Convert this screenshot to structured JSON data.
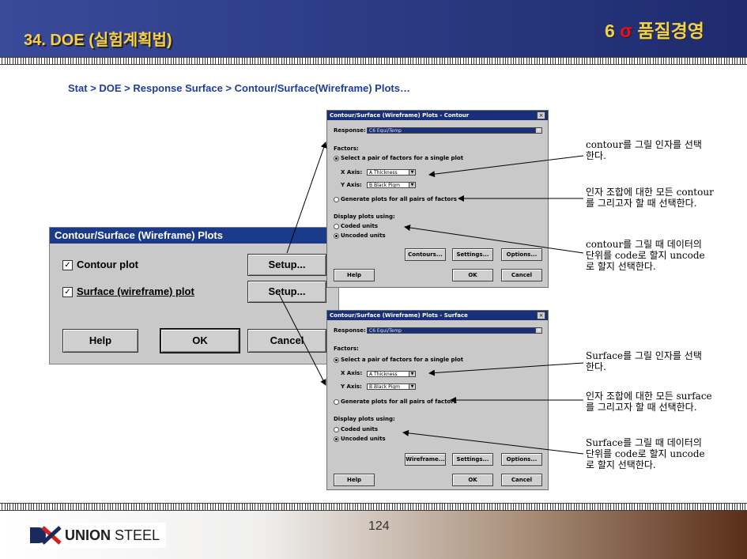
{
  "header": {
    "title": "34. DOE (실험계획법)",
    "brand_num": "6",
    "brand_sigma": "σ",
    "brand_text": "품질경영"
  },
  "path": "Stat > DOE > Response  Surface > Contour/Surface(Wireframe)  Plots…",
  "main_dialog": {
    "title": "Contour/Surface (Wireframe) Plots",
    "contour_label": "Contour plot",
    "surface_label": "Surface (wireframe) plot",
    "setup1": "Setup...",
    "setup2": "Setup...",
    "help": "Help",
    "ok": "OK",
    "cancel": "Cancel"
  },
  "contour_dialog": {
    "title": "Contour/Surface (Wireframe) Plots - Contour",
    "response_label": "Response:",
    "response_value": "C6     Equi/Temp",
    "factors": "Factors:",
    "single_pair": "Select a pair of factors for a single plot",
    "xaxis_label": "X Axis:",
    "xaxis_value": "A Thickness",
    "yaxis_label": "Y Axis:",
    "yaxis_value": "B Black Pigm",
    "all_pairs": "Generate plots for all pairs of factors",
    "display": "Display plots using:",
    "coded": "Coded units",
    "uncoded": "Uncoded units",
    "btn1": "Contours...",
    "btn2": "Settings...",
    "btn3": "Options...",
    "help": "Help",
    "ok": "OK",
    "cancel": "Cancel"
  },
  "surface_dialog": {
    "title": "Contour/Surface (Wireframe) Plots - Surface",
    "response_label": "Response:",
    "response_value": "C6     Equi/Temp",
    "factors": "Factors:",
    "single_pair": "Select a pair of factors for a single plot",
    "xaxis_label": "X Axis:",
    "xaxis_value": "A Thickness",
    "yaxis_label": "Y Axis:",
    "yaxis_value": "B Black Pigm",
    "all_pairs": "Generate plots for all pairs of factors",
    "display": "Display plots using:",
    "coded": "Coded units",
    "uncoded": "Uncoded units",
    "btn1": "Wireframe...",
    "btn2": "Settings...",
    "btn3": "Options...",
    "help": "Help",
    "ok": "OK",
    "cancel": "Cancel"
  },
  "notes": {
    "n1a": "contour를 그릴 인자를 선택",
    "n1b": "한다.",
    "n2a": "인자 조합에 대한 모든 contour",
    "n2b": "를 그리고자 할 때 선택한다.",
    "n3a": "contour를 그릴 때 데이터의",
    "n3b": "단위를 code로 할지 uncode",
    "n3c": "로 할지 선택한다.",
    "n4a": "Surface를 그릴 인자를 선택",
    "n4b": "한다.",
    "n5a": "인자 조합에 대한 모든 surface",
    "n5b": "를 그리고자 할 때 선택한다.",
    "n6a": "Surface를 그릴 때 데이터의",
    "n6b": "단위를 code로 할지 uncode",
    "n6c": "로 할지 선택한다."
  },
  "footer": {
    "logo_a": "UNION",
    "logo_b": " STEEL",
    "page": "124"
  },
  "colors": {
    "header_bg": "#2b3a85",
    "title_yellow": "#f6d04a",
    "path_blue": "#1f3ca0",
    "dialog_gray": "#c9c9c9",
    "titlebar_navy": "#1a2f7a"
  }
}
